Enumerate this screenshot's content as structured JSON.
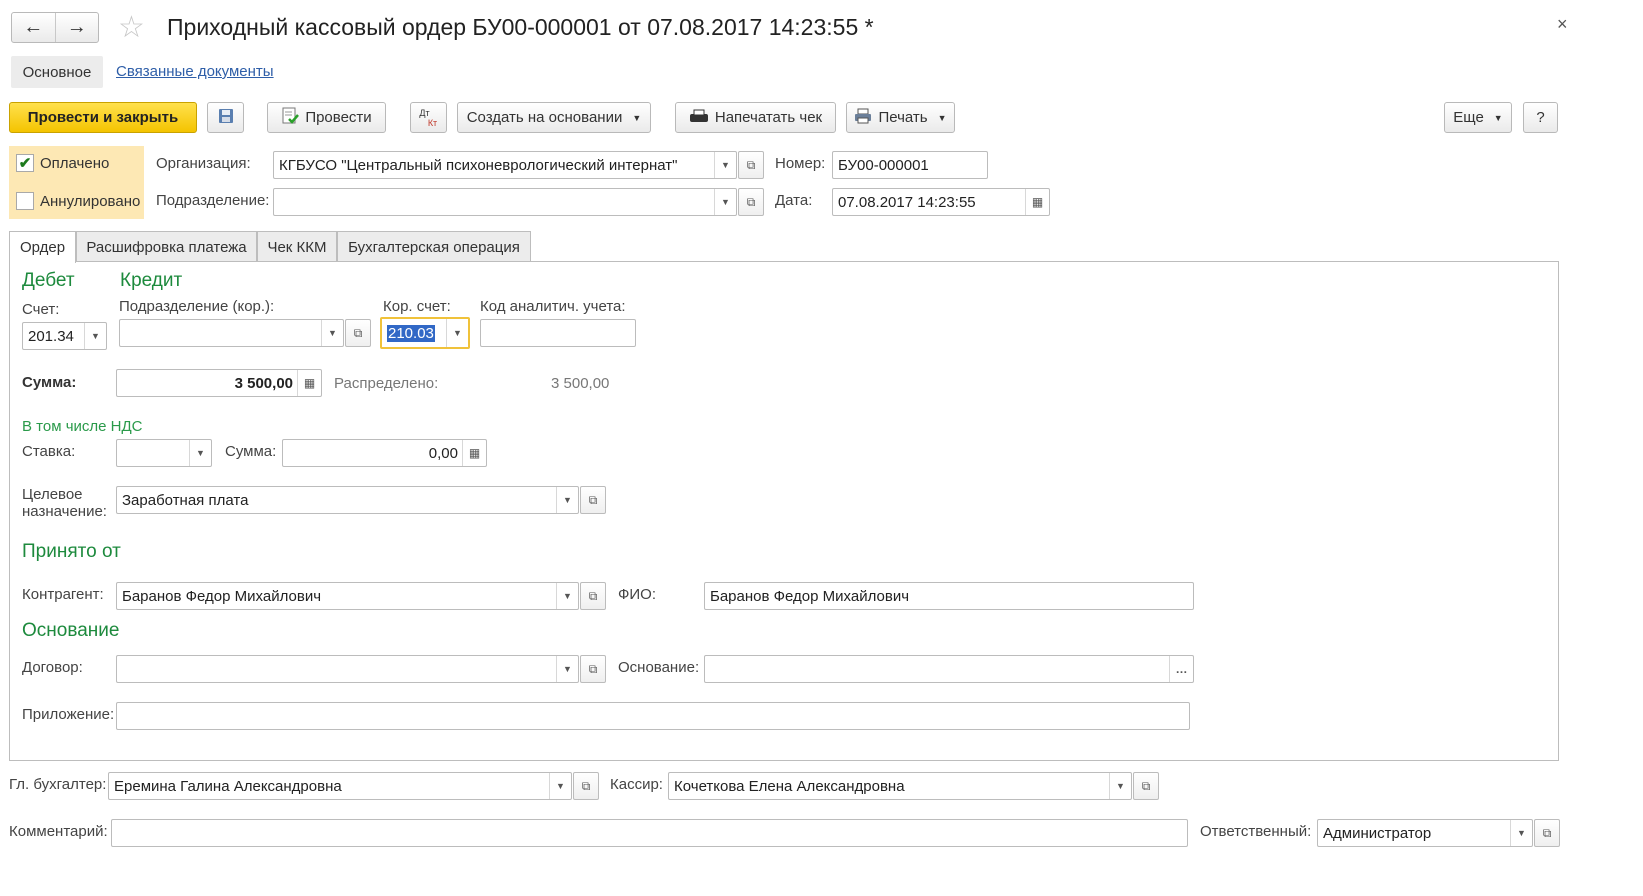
{
  "window": {
    "title": "Приходный кассовый ордер БУ00-000001 от 07.08.2017 14:23:55 *",
    "close_glyph": "×"
  },
  "nav": {
    "tabs": [
      "Основное",
      "Связанные документы"
    ]
  },
  "toolbar": {
    "post_close": "Провести и закрыть",
    "post": "Провести",
    "dt_kt_top": "Дт",
    "dt_kt_bottom": "Кт",
    "create_based": "Создать на основании",
    "print_receipt": "Напечатать чек",
    "print": "Печать",
    "more": "Еще",
    "help": "?"
  },
  "status": {
    "paid_label": "Оплачено",
    "paid_checked": true,
    "annulled_label": "Аннулировано",
    "annulled_checked": false
  },
  "header": {
    "org_label": "Организация:",
    "org_value": "КГБУСО \"Центральный психоневрологический интернат\"",
    "dept_label": "Подразделение:",
    "dept_value": "",
    "number_label": "Номер:",
    "number_value": "БУ00-000001",
    "date_label": "Дата:",
    "date_value": "07.08.2017 14:23:55"
  },
  "tabs": [
    "Ордер",
    "Расшифровка платежа",
    "Чек ККМ",
    "Бухгалтерская операция"
  ],
  "order": {
    "debit_title": "Дебет",
    "credit_title": "Кредит",
    "account_label": "Счет:",
    "account_value": "201.34",
    "dept_cor_label": "Подразделение (кор.):",
    "dept_cor_value": "",
    "cor_account_label": "Кор. счет:",
    "cor_account_value": "210.03",
    "analytic_label": "Код аналитич. учета:",
    "analytic_value": "",
    "sum_label": "Сумма:",
    "sum_value": "3 500,00",
    "distributed_label": "Распределено:",
    "distributed_value": "3 500,00",
    "vat_title": "В том числе НДС",
    "rate_label": "Ставка:",
    "rate_value": "",
    "vat_sum_label": "Сумма:",
    "vat_sum_value": "0,00",
    "purpose_label_1": "Целевое",
    "purpose_label_2": "назначение:",
    "purpose_value": "Заработная плата",
    "received_title": "Принято от",
    "counterparty_label": "Контрагент:",
    "counterparty_value": "Баранов Федор Михайлович",
    "fio_label": "ФИО:",
    "fio_value": "Баранов Федор Михайлович",
    "basis_title": "Основание",
    "contract_label": "Договор:",
    "contract_value": "",
    "basis_label": "Основание:",
    "basis_value": "",
    "attachment_label": "Приложение:",
    "attachment_value": ""
  },
  "footer": {
    "chief_label": "Гл. бухгалтер:",
    "chief_value": "Еремина Галина Александровна",
    "cashier_label": "Кассир:",
    "cashier_value": "Кочеткова Елена Александровна",
    "comment_label": "Комментарий:",
    "comment_value": "",
    "responsible_label": "Ответственный:",
    "responsible_value": "Администратор"
  },
  "colors": {
    "accent_green": "#1d8a3d",
    "primary_yellow": "#f4c400",
    "checkbox_bg": "#fde8b4",
    "selection_blue": "#3168c6"
  }
}
